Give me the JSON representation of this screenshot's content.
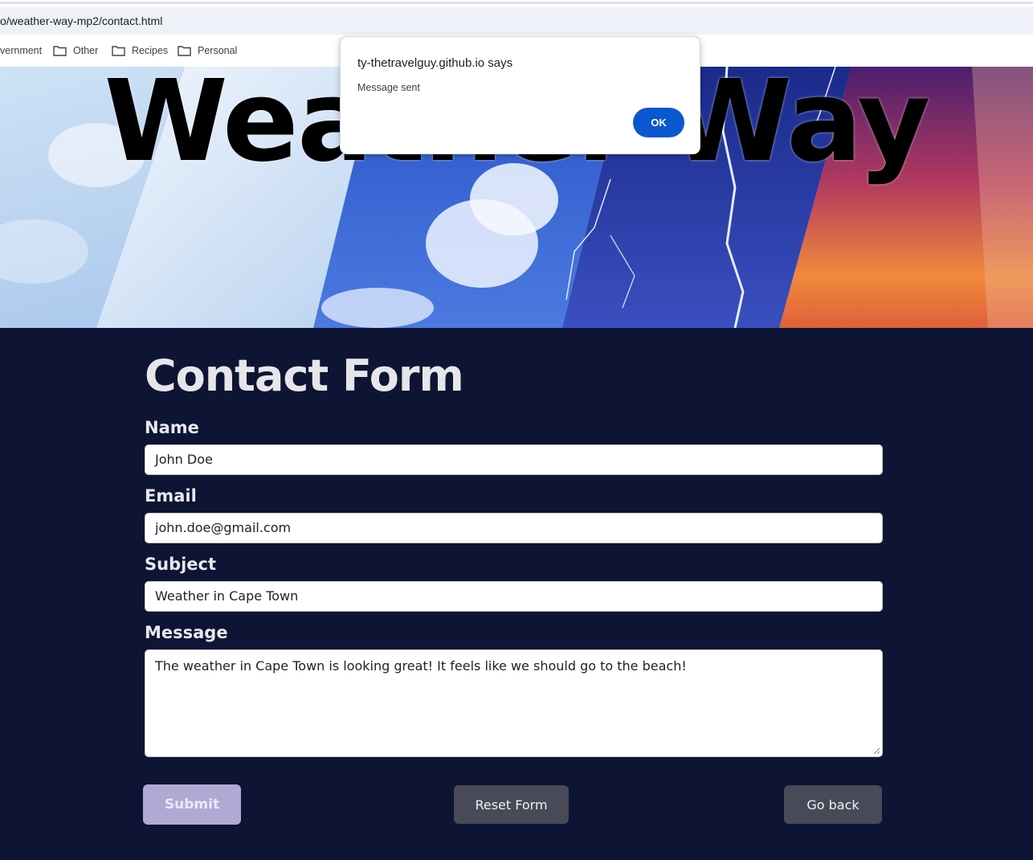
{
  "browser": {
    "url": "o/weather-way-mp2/contact.html",
    "bookmarks": [
      {
        "label": "vernment",
        "icon": "folder-icon"
      },
      {
        "label": "Other",
        "icon": "folder-icon"
      },
      {
        "label": "Recipes",
        "icon": "folder-icon"
      },
      {
        "label": "Personal",
        "icon": "folder-icon"
      }
    ]
  },
  "hero": {
    "title": "Weather Way"
  },
  "form": {
    "title": "Contact Form",
    "name_label": "Name",
    "name_value": "John Doe",
    "email_label": "Email",
    "email_value": "john.doe@gmail.com",
    "subject_label": "Subject",
    "subject_value": "Weather in Cape Town",
    "message_label": "Message",
    "message_value": "The weather in Cape Town is looking great! It feels like we should go to the beach!",
    "submit_label": "Submit",
    "reset_label": "Reset Form",
    "back_label": "Go back"
  },
  "dialog": {
    "title": "ty-thetravelguy.github.io says",
    "message": "Message sent",
    "ok_label": "OK"
  },
  "colors": {
    "page_bg": "#0e1433",
    "submit_bg": "#aeaad3",
    "button_bg": "#494a58",
    "dialog_ok": "#0b57d0"
  }
}
